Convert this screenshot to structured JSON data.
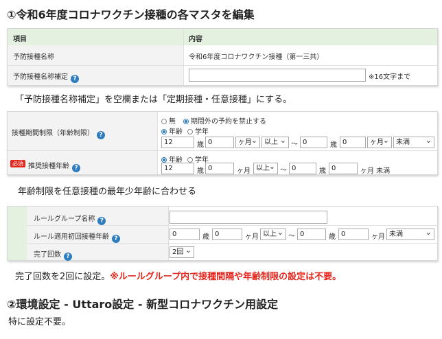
{
  "heading1": "①令和6年度コロナワクチン接種の各マスタを編集",
  "panel1": {
    "col_item": "項目",
    "col_content": "内容",
    "row1_label": "予防接種名称",
    "row1_value": "令和6年度コロナワクチン接種（第一三共）",
    "row2_label": "予防接種名称補定",
    "row2_value": "",
    "row2_hint": "※16文字まで",
    "help_glyph": "?"
  },
  "note1": "「予防接種名称補定」を空欄または「定期接種・任意接種」にする。",
  "panel2": {
    "row1_label": "接種期間制限（年齢制限）",
    "opt_none": "無",
    "opt_block": "期間外の予約を禁止する",
    "opt_age": "年齢",
    "opt_grade": "学年",
    "age_from_year": "12",
    "unit_year": "歳",
    "age_from_month": "0",
    "unit_month_sel": "ヶ月",
    "cmp_from": "以上",
    "tilde": "〜",
    "age_to_year": "0",
    "age_to_month": "0",
    "cmp_to": "未満",
    "required_badge": "必須",
    "row2_label": "推奨接種年齢",
    "rec_from_year": "12",
    "rec_from_month": "0",
    "unit_month": "ヶ月",
    "rec_cmp_from": "以上",
    "rec_to_year": "0",
    "rec_to_month": "0",
    "rec_to_suffix": "ヶ月 未満"
  },
  "note2": "年齢制限を任意接種の最年少年齢に合わせる",
  "panel3": {
    "row1_label": "ルールグループ名称",
    "row1_value": "",
    "row2_label": "ルール適用初回接種年齢",
    "from_year": "0",
    "unit_year": "歳",
    "from_month": "0",
    "unit_month": "ヶ月",
    "cmp_from": "以上",
    "tilde": "〜",
    "to_year": "0",
    "to_month": "0",
    "cmp_to": "未満",
    "row3_label": "完了回数",
    "count_value": "2回"
  },
  "note3_plain": "完了回数を2回に設定。",
  "note3_warn": "※ルールグループ内で接種間隔や年齢制限の設定は不要。",
  "heading2": "②環境設定 - Uttaro設定 - 新型コロナワクチン用設定",
  "note4": "特に設定不要。",
  "colors": {
    "accent": "#2f7dbf",
    "header_green": "#e4f1e1",
    "row_gray": "#f3f3f3",
    "required": "#e3251c",
    "warn": "#e3251c"
  }
}
